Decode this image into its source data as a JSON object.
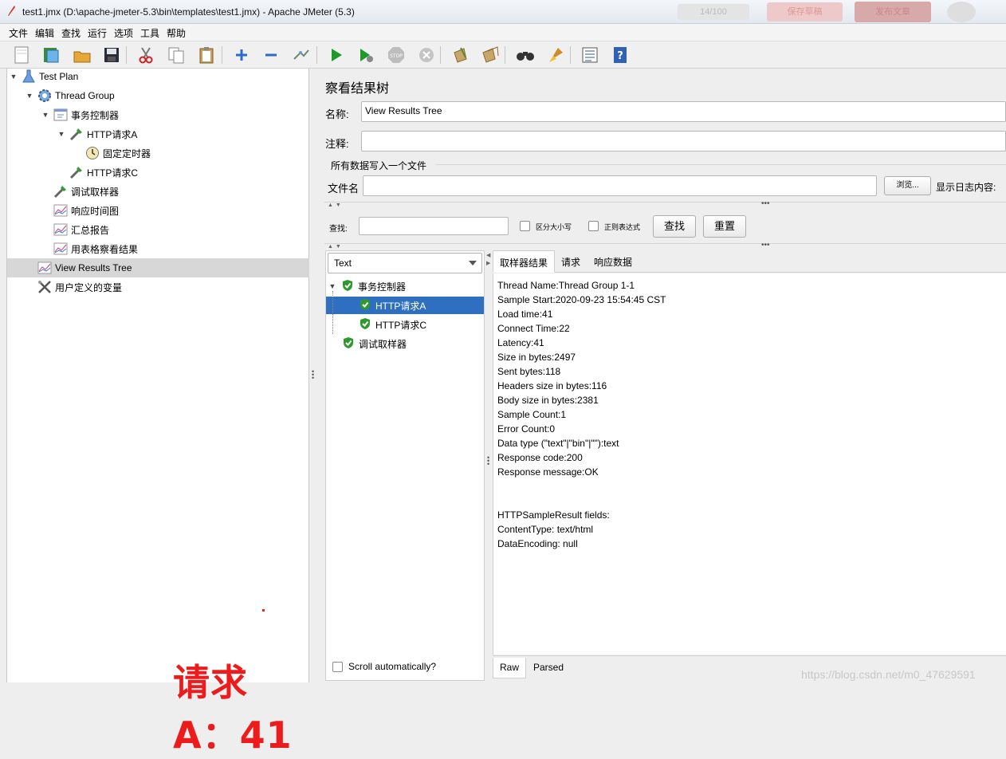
{
  "window": {
    "title": "test1.jmx (D:\\apache-jmeter-5.3\\bin\\templates\\test1.jmx) - Apache JMeter (5.3)",
    "blurred_badge": "14/100",
    "blurred_btn1": "保存草稿",
    "blurred_btn2": "发布文章"
  },
  "menu": [
    "文件",
    "编辑",
    "查找",
    "运行",
    "选项",
    "工具",
    "帮助"
  ],
  "toolbar_icons": [
    "new-icon",
    "templates-icon",
    "open-icon",
    "save-icon",
    "cut-icon",
    "copy-icon",
    "paste-icon",
    "expand-icon",
    "collapse-icon",
    "toggle-icon",
    "start-icon",
    "start-no-pause-icon",
    "stop-icon",
    "shutdown-icon",
    "clear-icon",
    "clear-all-icon",
    "search-icon",
    "reset-search-icon",
    "function-helper-icon",
    "help-icon"
  ],
  "tree": {
    "nodes": [
      {
        "label": "Test Plan",
        "icon": "test-plan-icon"
      },
      {
        "label": "Thread Group",
        "icon": "thread-group-icon"
      },
      {
        "label": "事务控制器",
        "icon": "transaction-controller-icon"
      },
      {
        "label": "HTTP请求A",
        "icon": "http-sampler-icon"
      },
      {
        "label": "固定定时器",
        "icon": "timer-icon"
      },
      {
        "label": "HTTP请求C",
        "icon": "http-sampler-icon"
      },
      {
        "label": "调试取样器",
        "icon": "debug-sampler-icon"
      },
      {
        "label": "响应时间图",
        "icon": "graph-icon"
      },
      {
        "label": "汇总报告",
        "icon": "graph-icon"
      },
      {
        "label": "用表格察看结果",
        "icon": "graph-icon"
      },
      {
        "label": "View Results Tree",
        "icon": "graph-icon"
      },
      {
        "label": "用户定义的变量",
        "icon": "user-vars-icon"
      }
    ],
    "selected": "View Results Tree"
  },
  "annotation": "请求A：41",
  "panel": {
    "title": "察看结果树",
    "name_label": "名称:",
    "name_value": "View Results Tree",
    "comment_label": "注释:",
    "comment_value": "",
    "file_group_label": "所有数据写入一个文件",
    "filename_label": "文件名",
    "filename_value": "",
    "browse_button": "浏览...",
    "log_label": "显示日志内容:",
    "search_label": "查找:",
    "search_value": "",
    "case_sensitive_label": "区分大小写",
    "regex_label": "正则表达式",
    "find_button": "查找",
    "reset_button": "重置"
  },
  "results": {
    "renderer": "Text",
    "nodes": [
      {
        "label": "事务控制器"
      },
      {
        "label": "HTTP请求A"
      },
      {
        "label": "HTTP请求C"
      },
      {
        "label": "调试取样器"
      }
    ],
    "selected": "HTTP请求A",
    "scroll_auto_label": "Scroll automatically?"
  },
  "tabs": [
    "取样器结果",
    "请求",
    "响应数据"
  ],
  "active_tab": "取样器结果",
  "details": [
    "Thread Name:Thread Group 1-1",
    "Sample Start:2020-09-23 15:54:45 CST",
    "Load time:41",
    "Connect Time:22",
    "Latency:41",
    "Size in bytes:2497",
    "Sent bytes:118",
    "Headers size in bytes:116",
    "Body size in bytes:2381",
    "Sample Count:1",
    "Error Count:0",
    "Data type (\"text\"|\"bin\"|\"\"):text",
    "Response code:200",
    "Response message:OK",
    "",
    "",
    "HTTPSampleResult fields:",
    "ContentType: text/html",
    "DataEncoding: null"
  ],
  "bottom_tabs": [
    "Raw",
    "Parsed"
  ],
  "watermark": "https://blog.csdn.net/m0_47629591"
}
